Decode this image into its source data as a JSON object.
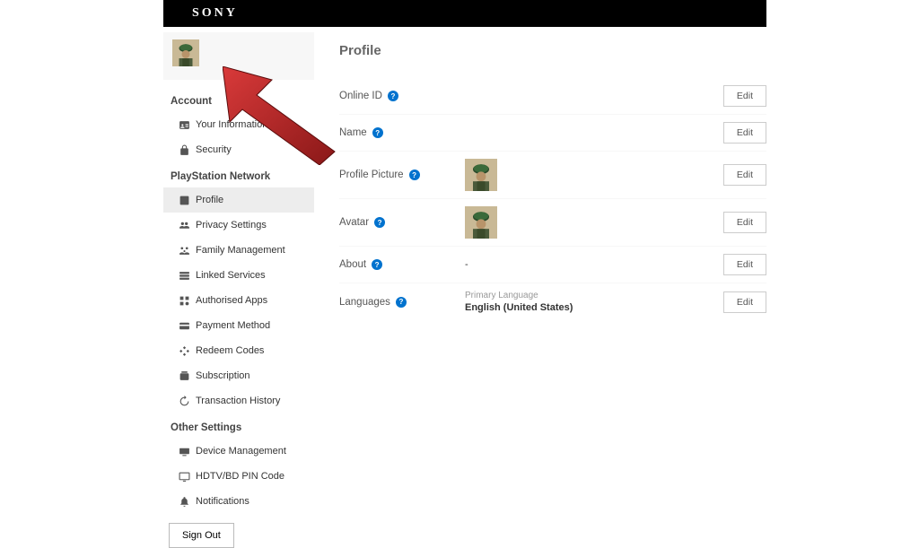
{
  "brand": "SONY",
  "sidebar": {
    "sections": [
      {
        "title": "Account",
        "items": [
          {
            "name": "your-information",
            "label": "Your Information"
          },
          {
            "name": "security",
            "label": "Security"
          }
        ]
      },
      {
        "title": "PlayStation Network",
        "items": [
          {
            "name": "profile",
            "label": "Profile",
            "active": true
          },
          {
            "name": "privacy-settings",
            "label": "Privacy Settings"
          },
          {
            "name": "family-management",
            "label": "Family Management"
          },
          {
            "name": "linked-services",
            "label": "Linked Services"
          },
          {
            "name": "authorised-apps",
            "label": "Authorised Apps"
          },
          {
            "name": "payment-method",
            "label": "Payment Method"
          },
          {
            "name": "redeem-codes",
            "label": "Redeem Codes"
          },
          {
            "name": "subscription",
            "label": "Subscription"
          },
          {
            "name": "transaction-history",
            "label": "Transaction History"
          }
        ]
      },
      {
        "title": "Other Settings",
        "items": [
          {
            "name": "device-management",
            "label": "Device Management"
          },
          {
            "name": "hdtv-pin",
            "label": "HDTV/BD PIN Code"
          },
          {
            "name": "notifications",
            "label": "Notifications"
          }
        ]
      }
    ],
    "sign_out": "Sign Out"
  },
  "main": {
    "title": "Profile",
    "edit_label": "Edit",
    "rows": {
      "online_id": {
        "label": "Online ID"
      },
      "name": {
        "label": "Name"
      },
      "profile_picture": {
        "label": "Profile Picture"
      },
      "avatar": {
        "label": "Avatar"
      },
      "about": {
        "label": "About",
        "value": "-"
      },
      "languages": {
        "label": "Languages",
        "sub": "Primary Language",
        "value": "English (United States)"
      }
    }
  }
}
